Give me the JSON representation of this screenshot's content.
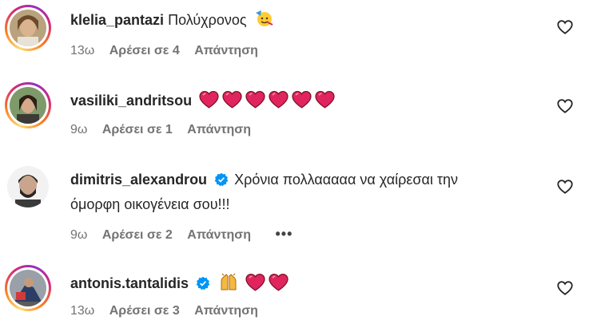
{
  "comments": [
    {
      "username": "klelia_pantazi",
      "text": "Πολύχρονος",
      "emojis": [
        "partying-face"
      ],
      "verified": false,
      "time": "13ω",
      "likes": "Αρέσει σε 4",
      "reply": "Απάντηση"
    },
    {
      "username": "vasiliki_andritsou",
      "text": "",
      "emojis": [
        "red-heart",
        "red-heart",
        "red-heart",
        "red-heart",
        "red-heart",
        "red-heart"
      ],
      "verified": false,
      "time": "9ω",
      "likes": "Αρέσει σε 1",
      "reply": "Απάντηση"
    },
    {
      "username": "dimitris_alexandrou",
      "text_line1": "Χρόνια πολλααααα να χαίρεσαι την",
      "text_line2": "όμορφη οικογένεια σου!!!",
      "verified": true,
      "time": "9ω",
      "likes": "Αρέσει σε 2",
      "reply": "Απάντηση",
      "more": "•••"
    },
    {
      "username": "antonis.tantalidis",
      "text": "",
      "emojis": [
        "raising-hands",
        "red-heart",
        "red-heart"
      ],
      "verified": true,
      "time": "13ω",
      "likes": "Αρέσει σε 3",
      "reply": "Απάντηση"
    }
  ],
  "colors": {
    "meta": "#737373",
    "verified": "#0095f6",
    "heart_emoji": "#e0245e",
    "text": "#262626"
  },
  "icons": {
    "like": "heart-outline-icon",
    "verified": "verified-badge-icon"
  }
}
